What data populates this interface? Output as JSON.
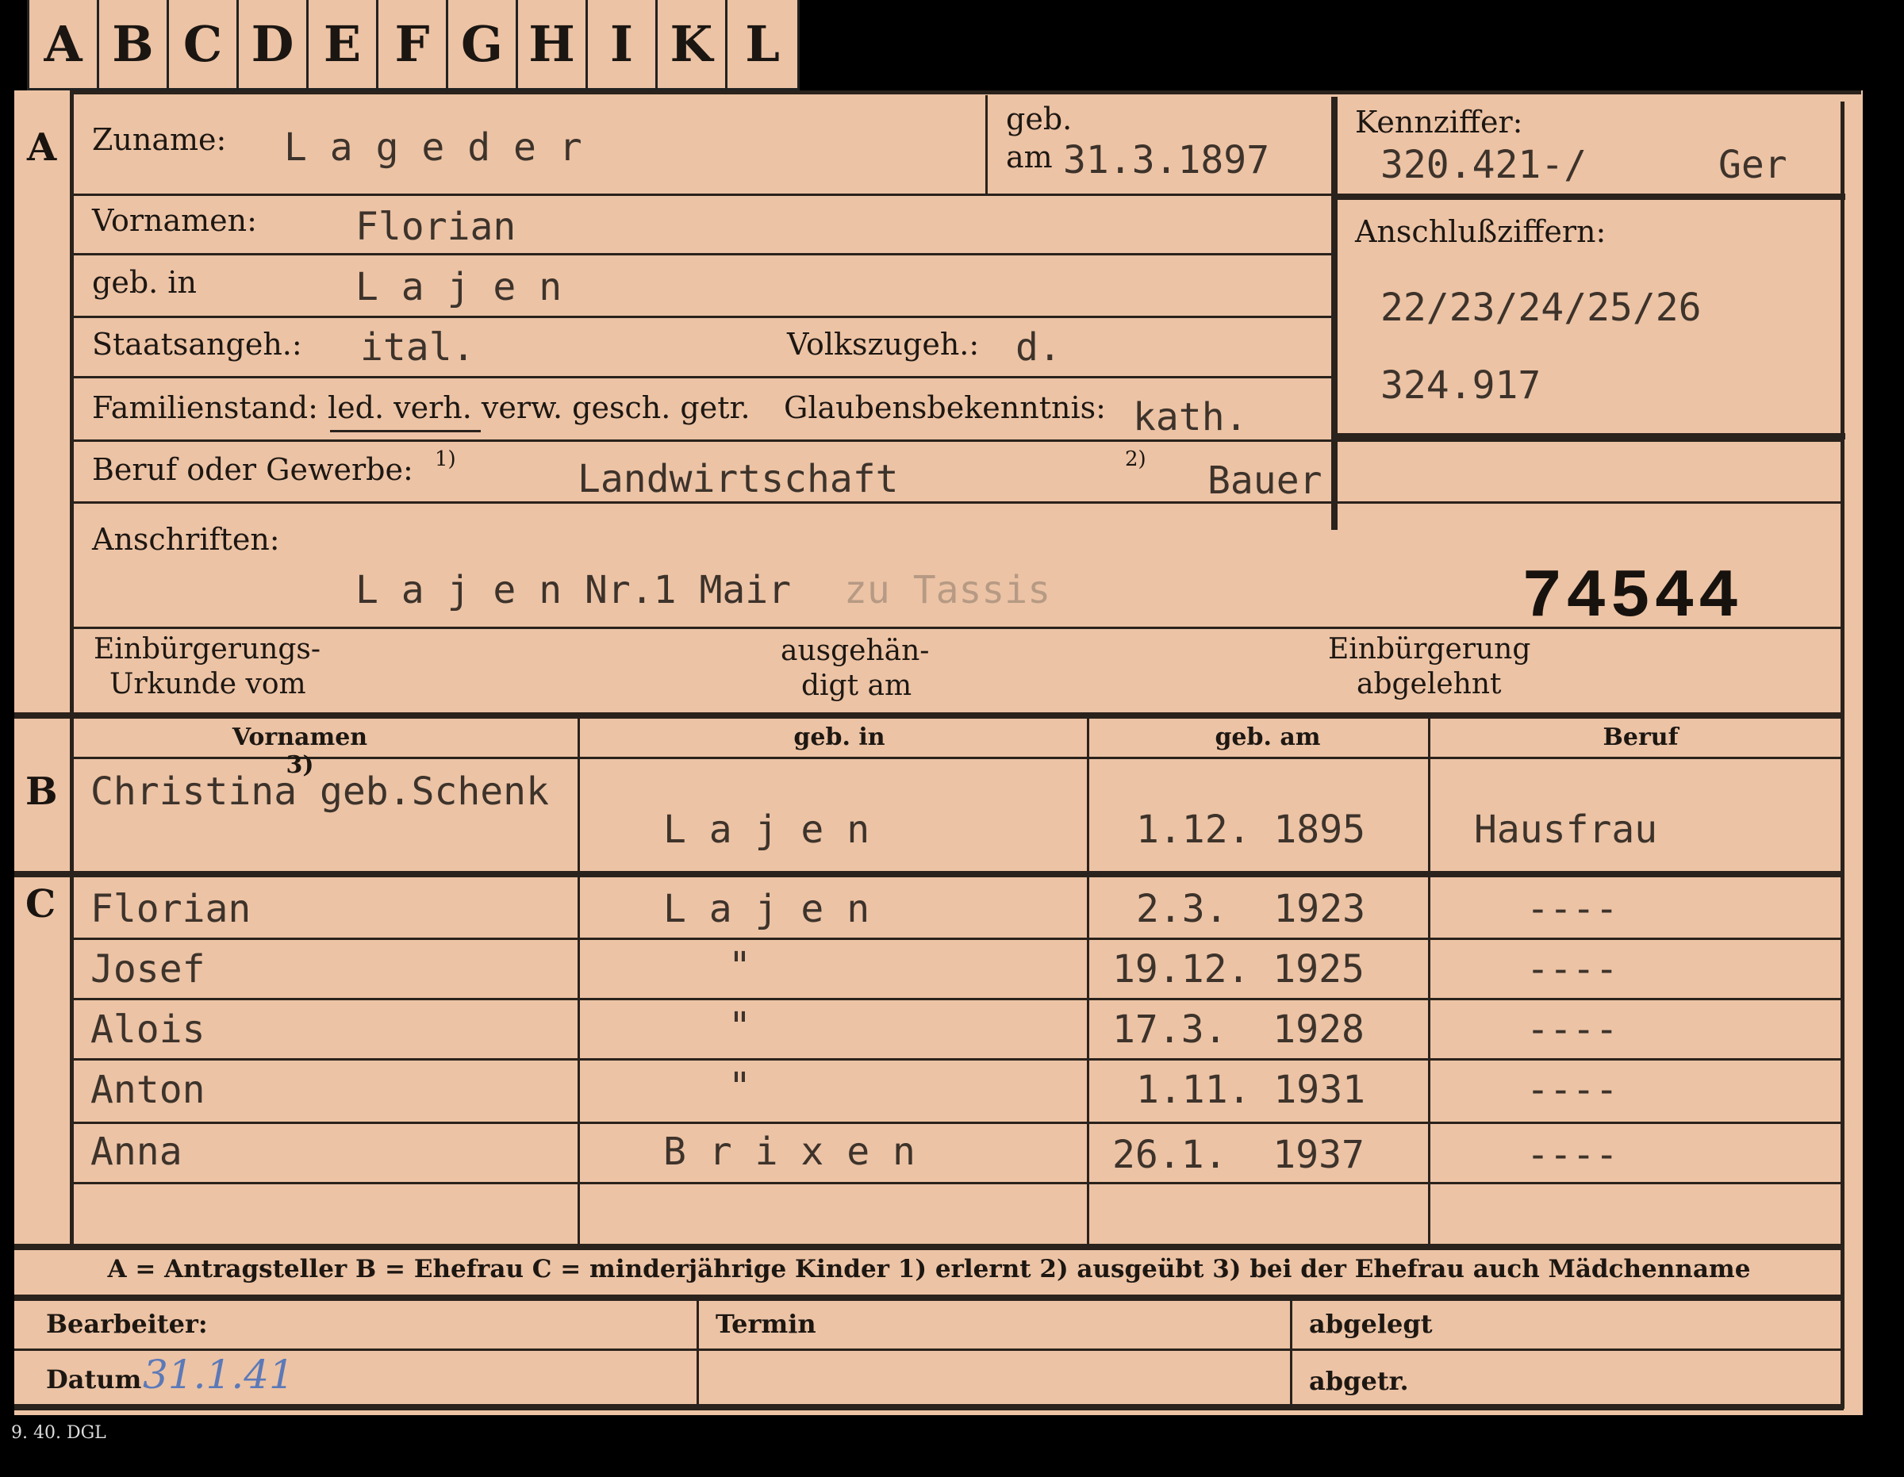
{
  "tabs": [
    "A",
    "B",
    "C",
    "D",
    "E",
    "F",
    "G",
    "H",
    "I",
    "K",
    "L"
  ],
  "section_a": {
    "marker": "A",
    "zuname_label": "Zuname:",
    "zuname_value": "L a g e d e r",
    "geb_label": "geb.",
    "geb_am_label": "am",
    "geb_am_value": "31.3.1897",
    "kennziffer_label": "Kennziffer:",
    "kennziffer_value": "320.421-/",
    "kennziffer_suffix": "Ger",
    "vornamen_label": "Vornamen:",
    "vornamen_value": "Florian",
    "geb_in_label": "geb. in",
    "geb_in_value": "L a j e n",
    "anschluss_label": "Anschlußziffern:",
    "anschluss_value_1": "22/23/24/25/26",
    "anschluss_value_2": "324.917",
    "staats_label": "Staatsangeh.:",
    "staats_value": "ital.",
    "volks_label": "Volkszugeh.:",
    "volks_value": "d.",
    "familienstand_label": "Familienstand: led. verh. verw. gesch. getr.",
    "glauben_label": "Glaubensbekenntnis:",
    "glauben_value": "kath.",
    "beruf_label": "Beruf oder Gewerbe:",
    "beruf_note1": "1)",
    "beruf_value1": "Landwirtschaft",
    "beruf_note2": "2)",
    "beruf_value2": "Bauer",
    "anschriften_label": "Anschriften:",
    "anschriften_value": "L a j e n Nr.1 Mair",
    "anschriften_faded": "zu Tassis",
    "stamp_number": "74544",
    "einb_urkunde_1": "Einbürgerungs-",
    "einb_urkunde_2": "Urkunde vom",
    "ausgehaend_1": "ausgehän-",
    "ausgehaend_2": "digt am",
    "einb_abgelehnt_1": "Einbürgerung",
    "einb_abgelehnt_2": "abgelehnt"
  },
  "table": {
    "headers": [
      "Vornamen 3)",
      "geb. in",
      "geb. am",
      "Beruf"
    ],
    "section_b": {
      "marker": "B",
      "row": [
        "Christina geb.Schenk",
        "L a j e n",
        "1.12. 1895",
        "Hausfrau"
      ]
    },
    "section_c": {
      "marker": "C",
      "rows": [
        [
          "Florian",
          "L a j e n",
          "2.3.  1923",
          "----"
        ],
        [
          "Josef",
          "\"",
          "19.12. 1925",
          "----"
        ],
        [
          "Alois",
          "\"",
          "17.3.  1928",
          "----"
        ],
        [
          "Anton",
          "\"",
          "1.11. 1931",
          "----"
        ],
        [
          "Anna",
          "B r i x e n",
          "26.1.  1937",
          "----"
        ]
      ]
    }
  },
  "legend": "A = Antragsteller   B = Ehefrau   C = minderjährige Kinder   1) erlernt   2) ausgeübt   3) bei der Ehefrau auch Mädchenname",
  "footer": {
    "bearbeiter_label": "Bearbeiter:",
    "termin_label": "Termin",
    "abgelegt_label": "abgelegt",
    "datum_label": "Datum",
    "datum_value": "31.1.41",
    "abgetr_label": "abgetr.",
    "print_code": "9. 40. DGL"
  },
  "colors": {
    "card": "#ecc3a5",
    "ink": "#1a1410",
    "typewriter": "#3d332b",
    "pencil_blue": "#5b79b8"
  }
}
